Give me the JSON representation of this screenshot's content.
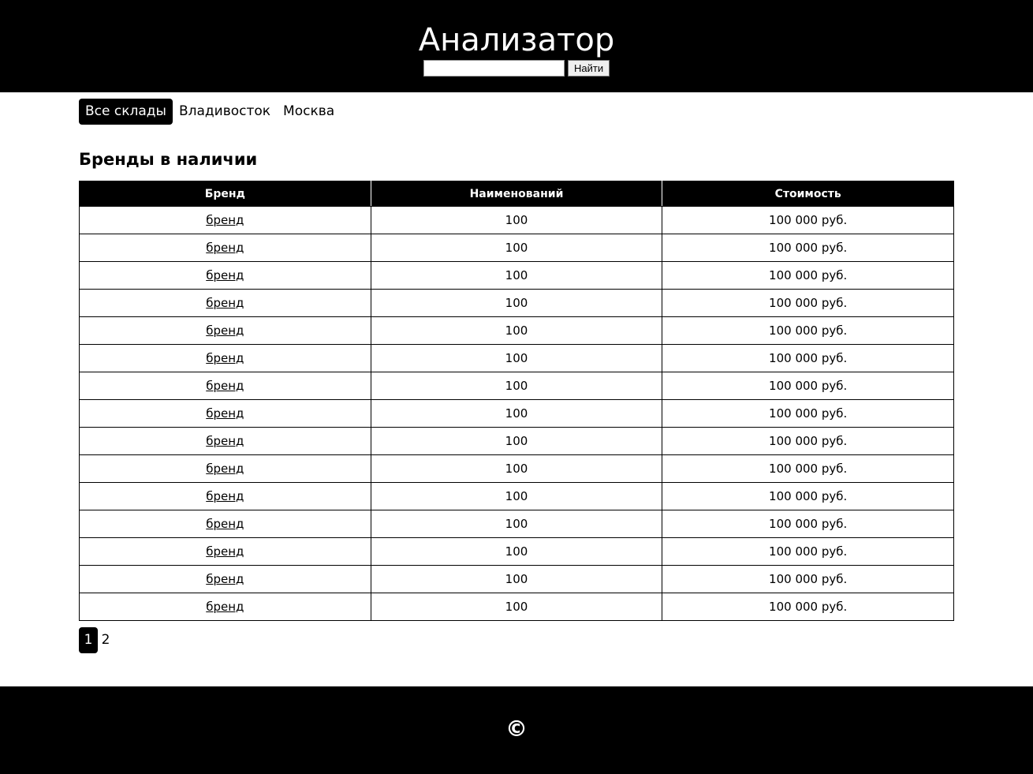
{
  "header": {
    "title": "Анализатор",
    "search": {
      "value": "",
      "placeholder": "",
      "button_label": "Найти"
    }
  },
  "tabs": [
    {
      "label": "Все склады",
      "active": true
    },
    {
      "label": "Владивосток",
      "active": false
    },
    {
      "label": "Москва",
      "active": false
    }
  ],
  "main": {
    "section_title": "Бренды в наличии",
    "table": {
      "columns": [
        "Бренд",
        "Наименований",
        "Стоимость"
      ],
      "rows": [
        {
          "brand": "бренд",
          "items": "100",
          "cost": "100 000 руб."
        },
        {
          "brand": "бренд",
          "items": "100",
          "cost": "100 000 руб."
        },
        {
          "brand": "бренд",
          "items": "100",
          "cost": "100 000 руб."
        },
        {
          "brand": "бренд",
          "items": "100",
          "cost": "100 000 руб."
        },
        {
          "brand": "бренд",
          "items": "100",
          "cost": "100 000 руб."
        },
        {
          "brand": "бренд",
          "items": "100",
          "cost": "100 000 руб."
        },
        {
          "brand": "бренд",
          "items": "100",
          "cost": "100 000 руб."
        },
        {
          "brand": "бренд",
          "items": "100",
          "cost": "100 000 руб."
        },
        {
          "brand": "бренд",
          "items": "100",
          "cost": "100 000 руб."
        },
        {
          "brand": "бренд",
          "items": "100",
          "cost": "100 000 руб."
        },
        {
          "brand": "бренд",
          "items": "100",
          "cost": "100 000 руб."
        },
        {
          "brand": "бренд",
          "items": "100",
          "cost": "100 000 руб."
        },
        {
          "brand": "бренд",
          "items": "100",
          "cost": "100 000 руб."
        },
        {
          "brand": "бренд",
          "items": "100",
          "cost": "100 000 руб."
        },
        {
          "brand": "бренд",
          "items": "100",
          "cost": "100 000 руб."
        }
      ]
    }
  },
  "pagination": {
    "pages": [
      {
        "label": "1",
        "active": true
      },
      {
        "label": "2",
        "active": false
      }
    ]
  },
  "footer": {
    "copyright": "©"
  },
  "colors": {
    "header_bg": "#000000",
    "footer_bg": "#000000",
    "active_tab_bg": "#000000",
    "page_bg": "#ffffff"
  }
}
